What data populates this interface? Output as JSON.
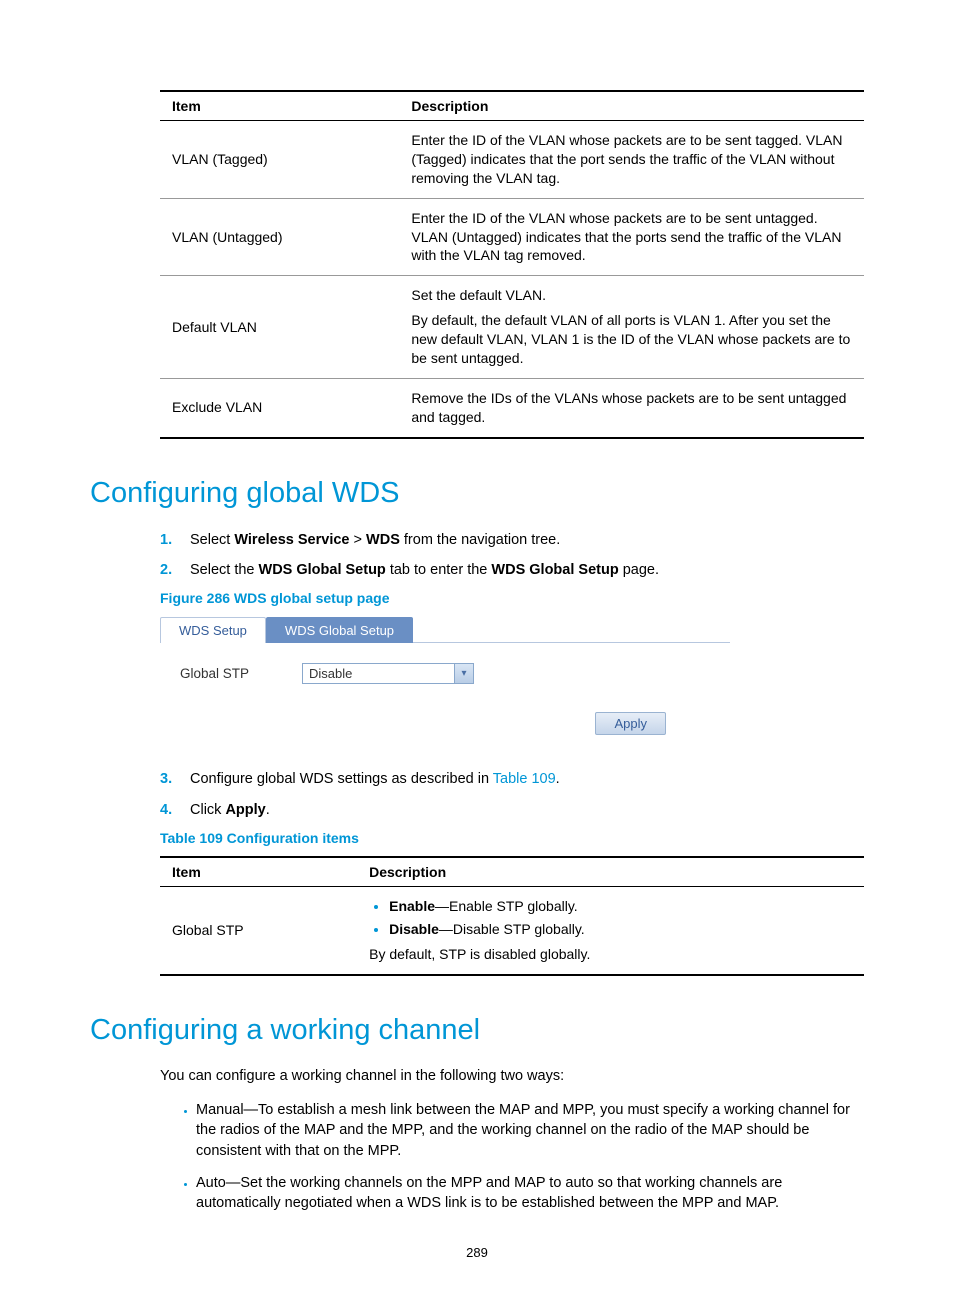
{
  "table1": {
    "headers": {
      "item": "Item",
      "desc": "Description"
    },
    "rows": [
      {
        "item": "VLAN (Tagged)",
        "desc": "Enter the ID of the VLAN whose packets are to be sent tagged. VLAN (Tagged) indicates that the port sends the traffic of the VLAN without removing the VLAN tag."
      },
      {
        "item": "VLAN (Untagged)",
        "desc": "Enter the ID of the VLAN whose packets are to be sent untagged. VLAN (Untagged) indicates that the ports send the traffic of the VLAN with the VLAN tag removed."
      },
      {
        "item": "Default VLAN",
        "desc_a": "Set the default VLAN.",
        "desc_b": "By default, the default VLAN of all ports is VLAN 1. After you set the new default VLAN, VLAN 1 is the ID of the VLAN whose packets are to be sent untagged."
      },
      {
        "item": "Exclude VLAN",
        "desc": "Remove the IDs of the VLANs whose packets are to be sent untagged and tagged."
      }
    ]
  },
  "section1": {
    "title": "Configuring global WDS",
    "steps": {
      "s1": {
        "pre": "Select ",
        "b1": "Wireless Service",
        "mid": " > ",
        "b2": "WDS",
        "post": " from the navigation tree."
      },
      "s2": {
        "pre": "Select the ",
        "b1": "WDS Global Setup",
        "mid": " tab to enter the ",
        "b2": "WDS Global Setup",
        "post": " page."
      },
      "s3": {
        "pre": "Configure global WDS settings as described in ",
        "link": "Table 109",
        "post": "."
      },
      "s4": {
        "pre": "Click ",
        "b1": "Apply",
        "post": "."
      }
    },
    "figure_caption": "Figure 286 WDS global setup page",
    "figure": {
      "tab1": "WDS Setup",
      "tab2": "WDS Global Setup",
      "form_label": "Global STP",
      "select_value": "Disable",
      "apply": "Apply"
    },
    "table_caption": "Table 109 Configuration items",
    "table109": {
      "headers": {
        "item": "Item",
        "desc": "Description"
      },
      "row": {
        "item": "Global STP",
        "b1_strong": "Enable",
        "b1_rest": "—Enable STP globally.",
        "b2_strong": "Disable",
        "b2_rest": "—Disable STP globally.",
        "footer": "By default, STP is disabled globally."
      }
    }
  },
  "section2": {
    "title": "Configuring a working channel",
    "intro": "You can configure a working channel in the following two ways:",
    "bullets": [
      "Manual—To establish a mesh link between the MAP and MPP, you must specify a working channel for the radios of the MAP and the MPP, and the working channel on the radio of the MAP should be consistent with that on the MPP.",
      "Auto—Set the working channels on the MPP and MAP to auto so that working channels are automatically negotiated when a WDS link is to be established between the MPP and MAP."
    ]
  },
  "numbers": {
    "n1": "1.",
    "n2": "2.",
    "n3": "3.",
    "n4": "4."
  },
  "page_number": "289"
}
